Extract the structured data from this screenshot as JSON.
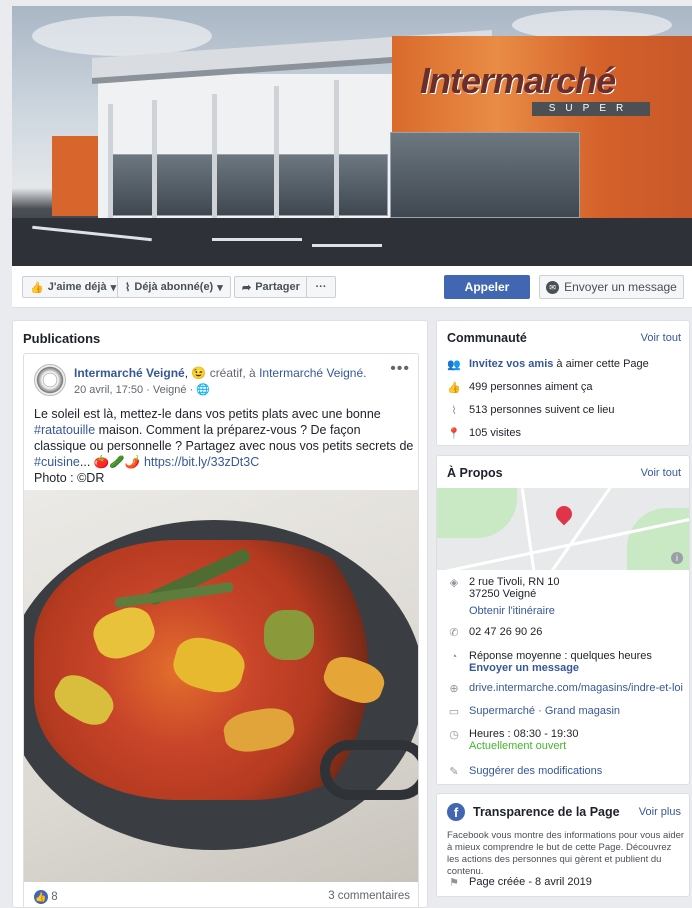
{
  "cover": {
    "store_logo": "Intermarché",
    "store_sub": "SUPER"
  },
  "actions": {
    "like": "J'aime déjà",
    "subscribed": "Déjà abonné(e)",
    "share": "Partager",
    "more": "···",
    "call": "Appeler",
    "message": "Envoyer un message"
  },
  "publications": {
    "title": "Publications",
    "post": {
      "author": "Intermarché Veigné",
      "feeling_emoji": "😉",
      "feeling": "créatif",
      "location_prefix": "à",
      "location": "Intermarché Veigné.",
      "date": "20 avril, 17:50",
      "place": "Veigné",
      "text_1": "Le soleil est là, mettez-le dans vos petits plats avec une bonne ",
      "hashtag_1": "#ratatouille",
      "text_2": " maison. Comment la préparez-vous ? De façon classique ou personnelle ? Partagez avec nous vos petits secrets de ",
      "hashtag_2": "#cuisine",
      "text_3": "... 🍅🥒🌶️ ",
      "link": "https://bit.ly/33zDt3C",
      "credit": "Photo : ©DR",
      "likes": "8",
      "comments": "3 commentaires"
    }
  },
  "community": {
    "title": "Communauté",
    "see_all": "Voir tout",
    "invite_link": "Invitez vos amis",
    "invite_rest": " à aimer cette Page",
    "likes": "499 personnes aiment ça",
    "followers": "513 personnes suivent ce lieu",
    "visits": "105 visites"
  },
  "about": {
    "title": "À Propos",
    "see_all": "Voir tout",
    "address_1": "2 rue Tivoli, RN 10",
    "address_2": "37250 Veigné",
    "directions": "Obtenir l'itinéraire",
    "phone": "02 47 26 90 26",
    "response": "Réponse moyenne : quelques heures",
    "send_message": "Envoyer un message",
    "website": "drive.intermarche.com/magasins/indre-et-loire/ve",
    "category_1": "Supermarché",
    "category_sep": " · ",
    "category_2": "Grand magasin",
    "hours": "Heures : 08:30 - 19:30",
    "open_now": "Actuellement ouvert",
    "suggest": "Suggérer des modifications"
  },
  "transparency": {
    "title": "Transparence de la Page",
    "see_more": "Voir plus",
    "description": "Facebook vous montre des informations pour vous aider à mieux comprendre le but de cette Page. Découvrez les actions des personnes qui gèrent et publient du contenu.",
    "created": "Page créée - 8 avril 2019"
  },
  "colors": {
    "facebook_blue": "#4267b2",
    "link_blue": "#365899",
    "open_green": "#42b72a"
  }
}
